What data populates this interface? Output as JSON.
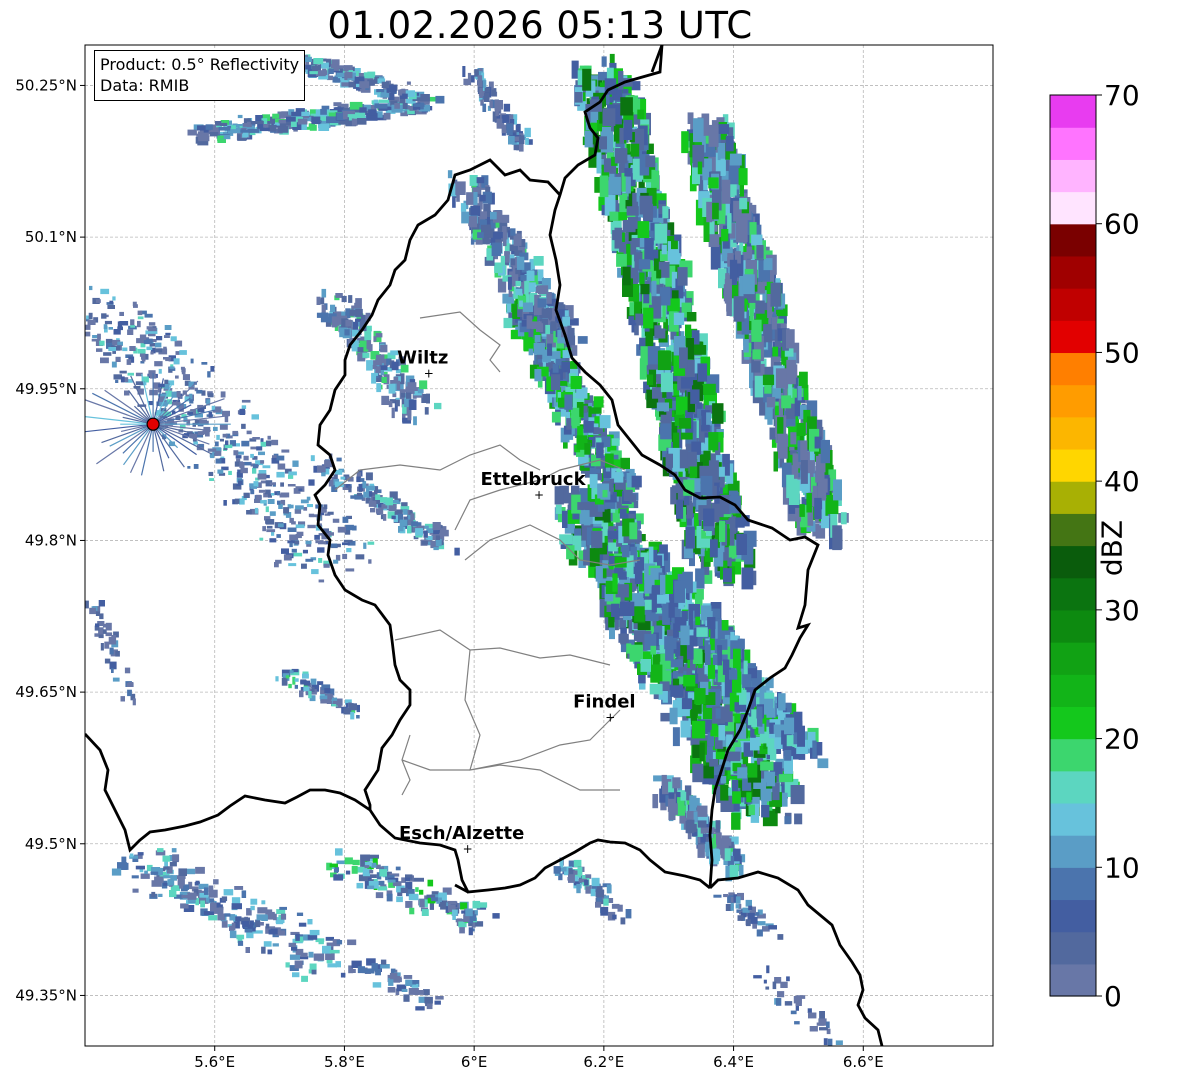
{
  "title": "01.02.2026 05:13 UTC",
  "info": {
    "product": "Product: 0.5° Reflectivity",
    "data": "Data: RMIB"
  },
  "map": {
    "lon_range": [
      5.4,
      6.8
    ],
    "lat_range": [
      49.3,
      50.29
    ],
    "x_ticks": [
      {
        "value": 5.6,
        "label": "5.6°E"
      },
      {
        "value": 5.8,
        "label": "5.8°E"
      },
      {
        "value": 6.0,
        "label": "6°E"
      },
      {
        "value": 6.2,
        "label": "6.2°E"
      },
      {
        "value": 6.4,
        "label": "6.4°E"
      },
      {
        "value": 6.6,
        "label": "6.6°E"
      }
    ],
    "y_ticks": [
      {
        "value": 50.25,
        "label": "50.25°N"
      },
      {
        "value": 50.1,
        "label": "50.1°N"
      },
      {
        "value": 49.95,
        "label": "49.95°N"
      },
      {
        "value": 49.8,
        "label": "49.8°N"
      },
      {
        "value": 49.65,
        "label": "49.65°N"
      },
      {
        "value": 49.5,
        "label": "49.5°N"
      },
      {
        "value": 49.35,
        "label": "49.35°N"
      }
    ],
    "cities": [
      {
        "name": "Wiltz",
        "lon": 5.93,
        "lat": 49.965
      },
      {
        "name": "Ettelbruck",
        "lon": 6.1,
        "lat": 49.845
      },
      {
        "name": "Findel",
        "lon": 6.21,
        "lat": 49.625
      },
      {
        "name": "Esch/Alzette",
        "lon": 5.99,
        "lat": 49.495
      }
    ],
    "radar_site": {
      "lon": 5.505,
      "lat": 49.915,
      "color": "#e00000"
    }
  },
  "colorbar": {
    "label": "dBZ",
    "min": 0,
    "max": 70,
    "ticks": [
      0,
      10,
      20,
      30,
      40,
      50,
      60,
      70
    ],
    "colors": [
      "#6877a7",
      "#52699e",
      "#435ea1",
      "#4b74ad",
      "#5a9dc6",
      "#67c2dc",
      "#5cd6c0",
      "#3cd66e",
      "#14c81c",
      "#12b418",
      "#11a214",
      "#0d8a10",
      "#0b7410",
      "#0a5c0c",
      "#447514",
      "#a8b004",
      "#ffd600",
      "#fcb600",
      "#ff9c00",
      "#ff7f00",
      "#e20000",
      "#c00000",
      "#a00000",
      "#7a0000",
      "#ffe4ff",
      "#ffb4ff",
      "#ff74ff",
      "#e83cf0"
    ]
  }
}
